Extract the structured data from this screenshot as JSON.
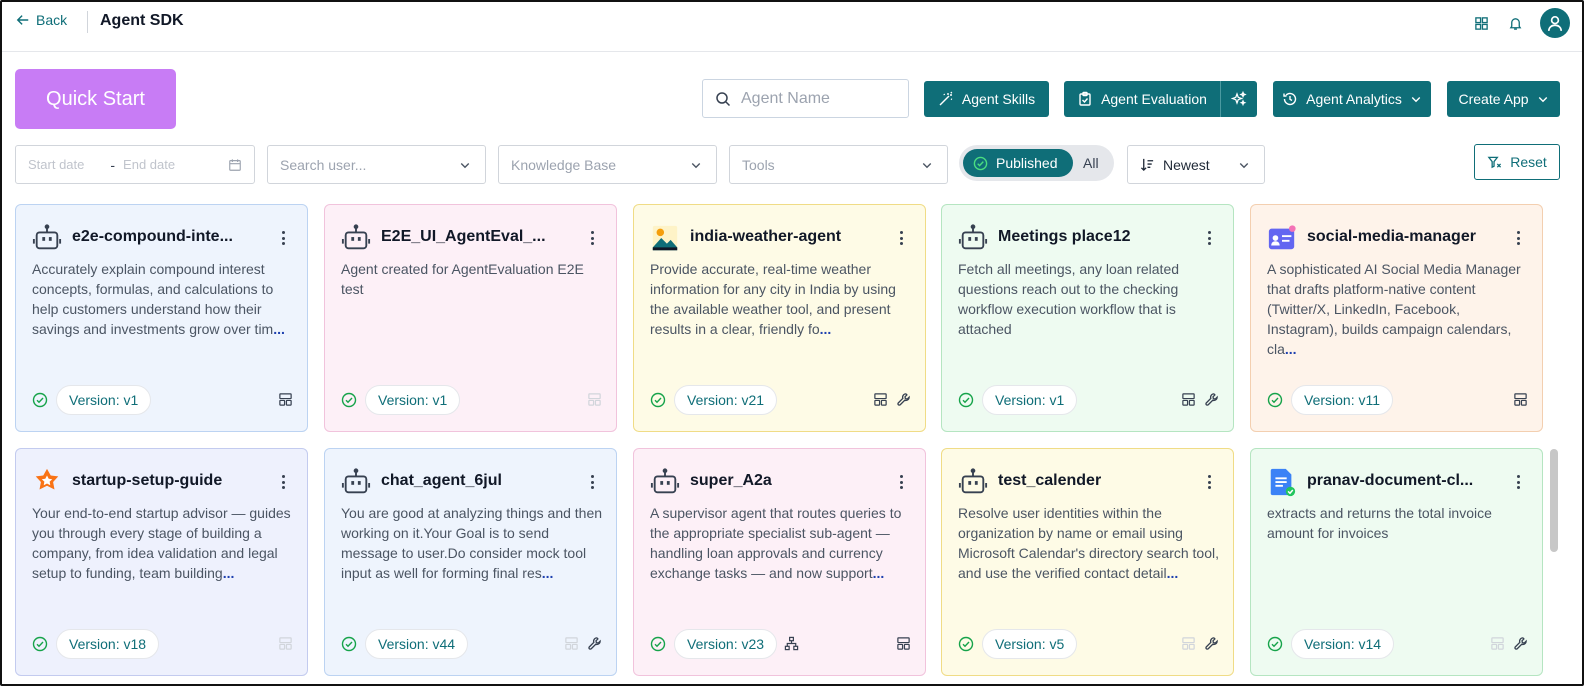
{
  "header": {
    "back_label": "Back",
    "title": "Agent SDK",
    "icons": [
      "grid-icon",
      "bell-icon",
      "user-avatar-icon"
    ]
  },
  "toolbar": {
    "quick_start": "Quick Start",
    "search_placeholder": "Agent Name",
    "agent_skills": "Agent Skills",
    "agent_evaluation": "Agent Evaluation",
    "agent_analytics": "Agent Analytics",
    "create_app": "Create App"
  },
  "filters": {
    "start_date_placeholder": "Start date",
    "date_separator": "-",
    "end_date_placeholder": "End date",
    "user_placeholder": "Search user...",
    "knowledge_base_placeholder": "Knowledge Base",
    "tools_placeholder": "Tools",
    "toggle_published": "Published",
    "toggle_all": "All",
    "sort_value": "Newest",
    "reset": "Reset"
  },
  "colors": {
    "accent": "#0f6e78",
    "quick_start": "#c87cf5"
  },
  "cards": [
    {
      "name": "e2e-compound-inte...",
      "icon": "robot-icon",
      "desc": "Accurately explain compound interest concepts, formulas, and calculations to help customers understand how their savings and investments grow over tim",
      "more": "...",
      "version": "Version: v1",
      "bg": "#eef4fd",
      "border": "#bcd3f2",
      "tools": [
        "layout"
      ],
      "tools_muted": false,
      "org": false
    },
    {
      "name": "E2E_UI_AgentEval_...",
      "icon": "robot-icon",
      "desc": "Agent created for AgentEvaluation E2E test",
      "more": "",
      "version": "Version: v1",
      "bg": "#fdf0f7",
      "border": "#f1c3dc",
      "tools": [
        "layout"
      ],
      "tools_muted": true,
      "org": false
    },
    {
      "name": "india-weather-agent",
      "icon": "landscape-icon",
      "desc": "Provide accurate, real-time weather information for any city in India by using the available weather tool, and present results in a clear, friendly fo",
      "more": "...",
      "version": "Version: v21",
      "bg": "#fefbe6",
      "border": "#f0dc86",
      "tools": [
        "layout",
        "wrench"
      ],
      "tools_muted": false,
      "org": false
    },
    {
      "name": "Meetings place12",
      "icon": "robot-icon",
      "desc": "Fetch all meetings, any loan related questions reach out to the checking workflow execution workflow that is attached",
      "more": "",
      "version": "Version: v1",
      "bg": "#eefbf1",
      "border": "#b5e5c1",
      "tools": [
        "layout",
        "wrench"
      ],
      "tools_muted": false,
      "org": false
    },
    {
      "name": "social-media-manager",
      "icon": "id-card-icon",
      "desc": "A sophisticated AI Social Media Manager that drafts platform-native content (Twitter/X, LinkedIn, Facebook, Instagram), builds campaign calendars, cla",
      "more": "...",
      "version": "Version: v11",
      "bg": "#fef3ea",
      "border": "#f3cfb0",
      "tools": [
        "layout"
      ],
      "tools_muted": false,
      "org": false
    },
    {
      "name": "startup-setup-guide",
      "icon": "star-badge-icon",
      "desc": "Your end-to-end startup advisor — guides you through every stage of building a company, from idea validation and legal setup to funding, team building",
      "more": "...",
      "version": "Version: v18",
      "bg": "#eef1fd",
      "border": "#c3cbef",
      "tools": [
        "layout"
      ],
      "tools_muted": true,
      "org": false
    },
    {
      "name": "chat_agent_6jul",
      "icon": "robot-icon",
      "desc": "You are good at analyzing things and then working on it.Your Goal is to send message to user.Do consider mock tool input as well for forming final res",
      "more": "...",
      "version": "Version: v44",
      "bg": "#eef4fd",
      "border": "#bcd3f2",
      "tools": [
        "layout",
        "wrench"
      ],
      "tools_muted": "first",
      "org": false
    },
    {
      "name": "super_A2a",
      "icon": "robot-icon",
      "desc": "A supervisor agent that routes queries to the appropriate specialist sub-agent — handling loan approvals and currency exchange tasks — and now support",
      "more": "...",
      "version": "Version: v23",
      "bg": "#fdf0f7",
      "border": "#f1c3dc",
      "tools": [
        "layout"
      ],
      "tools_muted": false,
      "org": true
    },
    {
      "name": "test_calender",
      "icon": "robot-icon",
      "desc": "Resolve user identities within the organization by name or email using Microsoft Calendar's directory search tool, and use the verified contact detail",
      "more": "...",
      "version": "Version: v5",
      "bg": "#fefbe6",
      "border": "#f0dc86",
      "tools": [
        "layout",
        "wrench"
      ],
      "tools_muted": "first",
      "org": false
    },
    {
      "name": "pranav-document-cl...",
      "icon": "document-icon",
      "desc": "extracts and returns the total invoice amount for invoices",
      "more": "",
      "version": "Version: v14",
      "bg": "#eefbf1",
      "border": "#b5e5c1",
      "tools": [
        "layout",
        "wrench"
      ],
      "tools_muted": "first",
      "org": false
    }
  ]
}
